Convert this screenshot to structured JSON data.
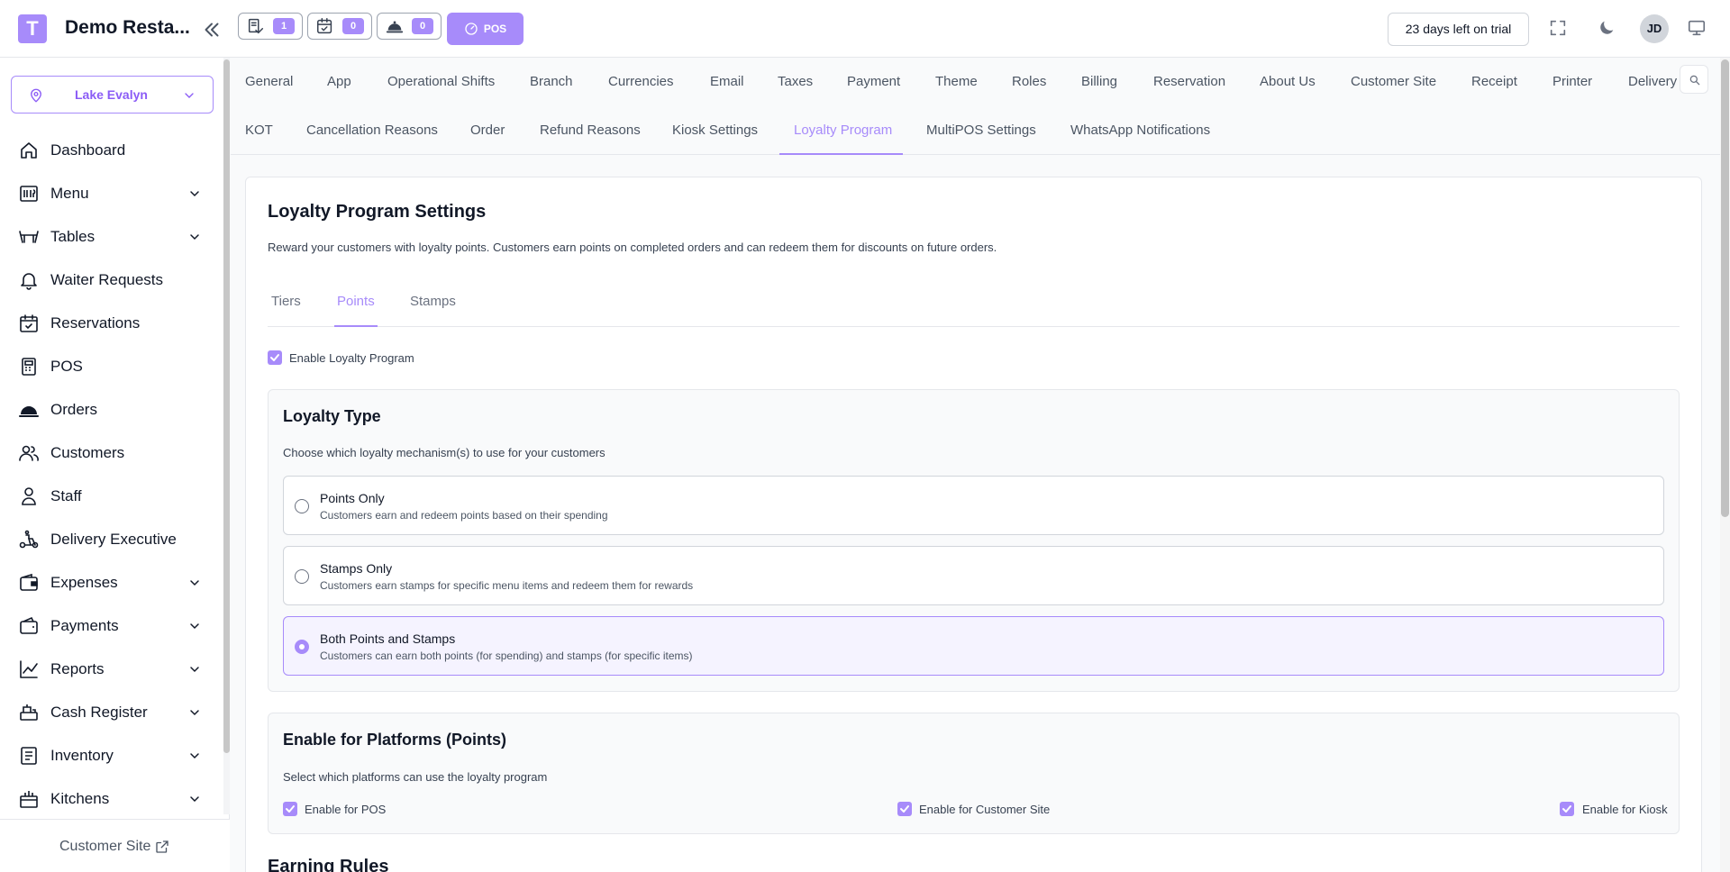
{
  "header": {
    "logo_letter": "T",
    "restaurant_name": "Demo Resta...",
    "counters": [
      {
        "name": "waiter-requests",
        "count": "1"
      },
      {
        "name": "reservations",
        "count": "0"
      },
      {
        "name": "orders",
        "count": "0"
      }
    ],
    "pos_label": "POS",
    "trial_text": "23 days left on trial",
    "avatar_initials": "JD"
  },
  "sidebar": {
    "branch": "Lake Evalyn",
    "items": [
      {
        "label": "Dashboard",
        "icon": "home-icon",
        "expandable": false
      },
      {
        "label": "Menu",
        "icon": "menu-book-icon",
        "expandable": true
      },
      {
        "label": "Tables",
        "icon": "table-icon",
        "expandable": true
      },
      {
        "label": "Waiter Requests",
        "icon": "bell-icon",
        "expandable": false
      },
      {
        "label": "Reservations",
        "icon": "calendar-check-icon",
        "expandable": false
      },
      {
        "label": "POS",
        "icon": "pos-terminal-icon",
        "expandable": false
      },
      {
        "label": "Orders",
        "icon": "cloche-icon",
        "expandable": false
      },
      {
        "label": "Customers",
        "icon": "users-icon",
        "expandable": false
      },
      {
        "label": "Staff",
        "icon": "staff-icon",
        "expandable": false
      },
      {
        "label": "Delivery Executive",
        "icon": "scooter-icon",
        "expandable": false
      },
      {
        "label": "Expenses",
        "icon": "wallet-icon",
        "expandable": true
      },
      {
        "label": "Payments",
        "icon": "payment-icon",
        "expandable": true
      },
      {
        "label": "Reports",
        "icon": "chart-line-icon",
        "expandable": true
      },
      {
        "label": "Cash Register",
        "icon": "cash-register-icon",
        "expandable": true
      },
      {
        "label": "Inventory",
        "icon": "inventory-icon",
        "expandable": true
      },
      {
        "label": "Kitchens",
        "icon": "kitchen-icon",
        "expandable": true
      }
    ],
    "footer_link": "Customer Site"
  },
  "settings_tabs": {
    "row1": [
      "General",
      "App",
      "Operational Shifts",
      "Branch",
      "Currencies",
      "Email",
      "Taxes",
      "Payment",
      "Theme",
      "Roles",
      "Billing",
      "Reservation",
      "About Us",
      "Customer Site",
      "Receipt",
      "Printer",
      "Delivery"
    ],
    "row2": [
      "KOT",
      "Cancellation Reasons",
      "Order",
      "Refund Reasons",
      "Kiosk Settings",
      "Loyalty Program",
      "MultiPOS Settings",
      "WhatsApp Notifications"
    ],
    "active": "Loyalty Program"
  },
  "loyalty": {
    "title": "Loyalty Program Settings",
    "description": "Reward your customers with loyalty points. Customers earn points on completed orders and can redeem them for discounts on future orders.",
    "tabs": [
      "Tiers",
      "Points",
      "Stamps"
    ],
    "active_tab": "Points",
    "enable_label": "Enable Loyalty Program",
    "enable_checked": true,
    "type_section": {
      "title": "Loyalty Type",
      "description": "Choose which loyalty mechanism(s) to use for your customers",
      "options": [
        {
          "title": "Points Only",
          "description": "Customers earn and redeem points based on their spending",
          "selected": false
        },
        {
          "title": "Stamps Only",
          "description": "Customers earn stamps for specific menu items and redeem them for rewards",
          "selected": false
        },
        {
          "title": "Both Points and Stamps",
          "description": "Customers can earn both points (for spending) and stamps (for specific items)",
          "selected": true
        }
      ]
    },
    "platforms_section": {
      "title": "Enable for Platforms (Points)",
      "description": "Select which platforms can use the loyalty program",
      "options": [
        {
          "label": "Enable for POS",
          "checked": true
        },
        {
          "label": "Enable for Customer Site",
          "checked": true
        },
        {
          "label": "Enable for Kiosk",
          "checked": true
        }
      ]
    },
    "next_section_title": "Earning Rules"
  },
  "colors": {
    "accent": "#a78bfa",
    "accent_light": "#f5f3ff",
    "text": "#111827",
    "muted": "#4b5563",
    "border": "#e5e7eb"
  }
}
